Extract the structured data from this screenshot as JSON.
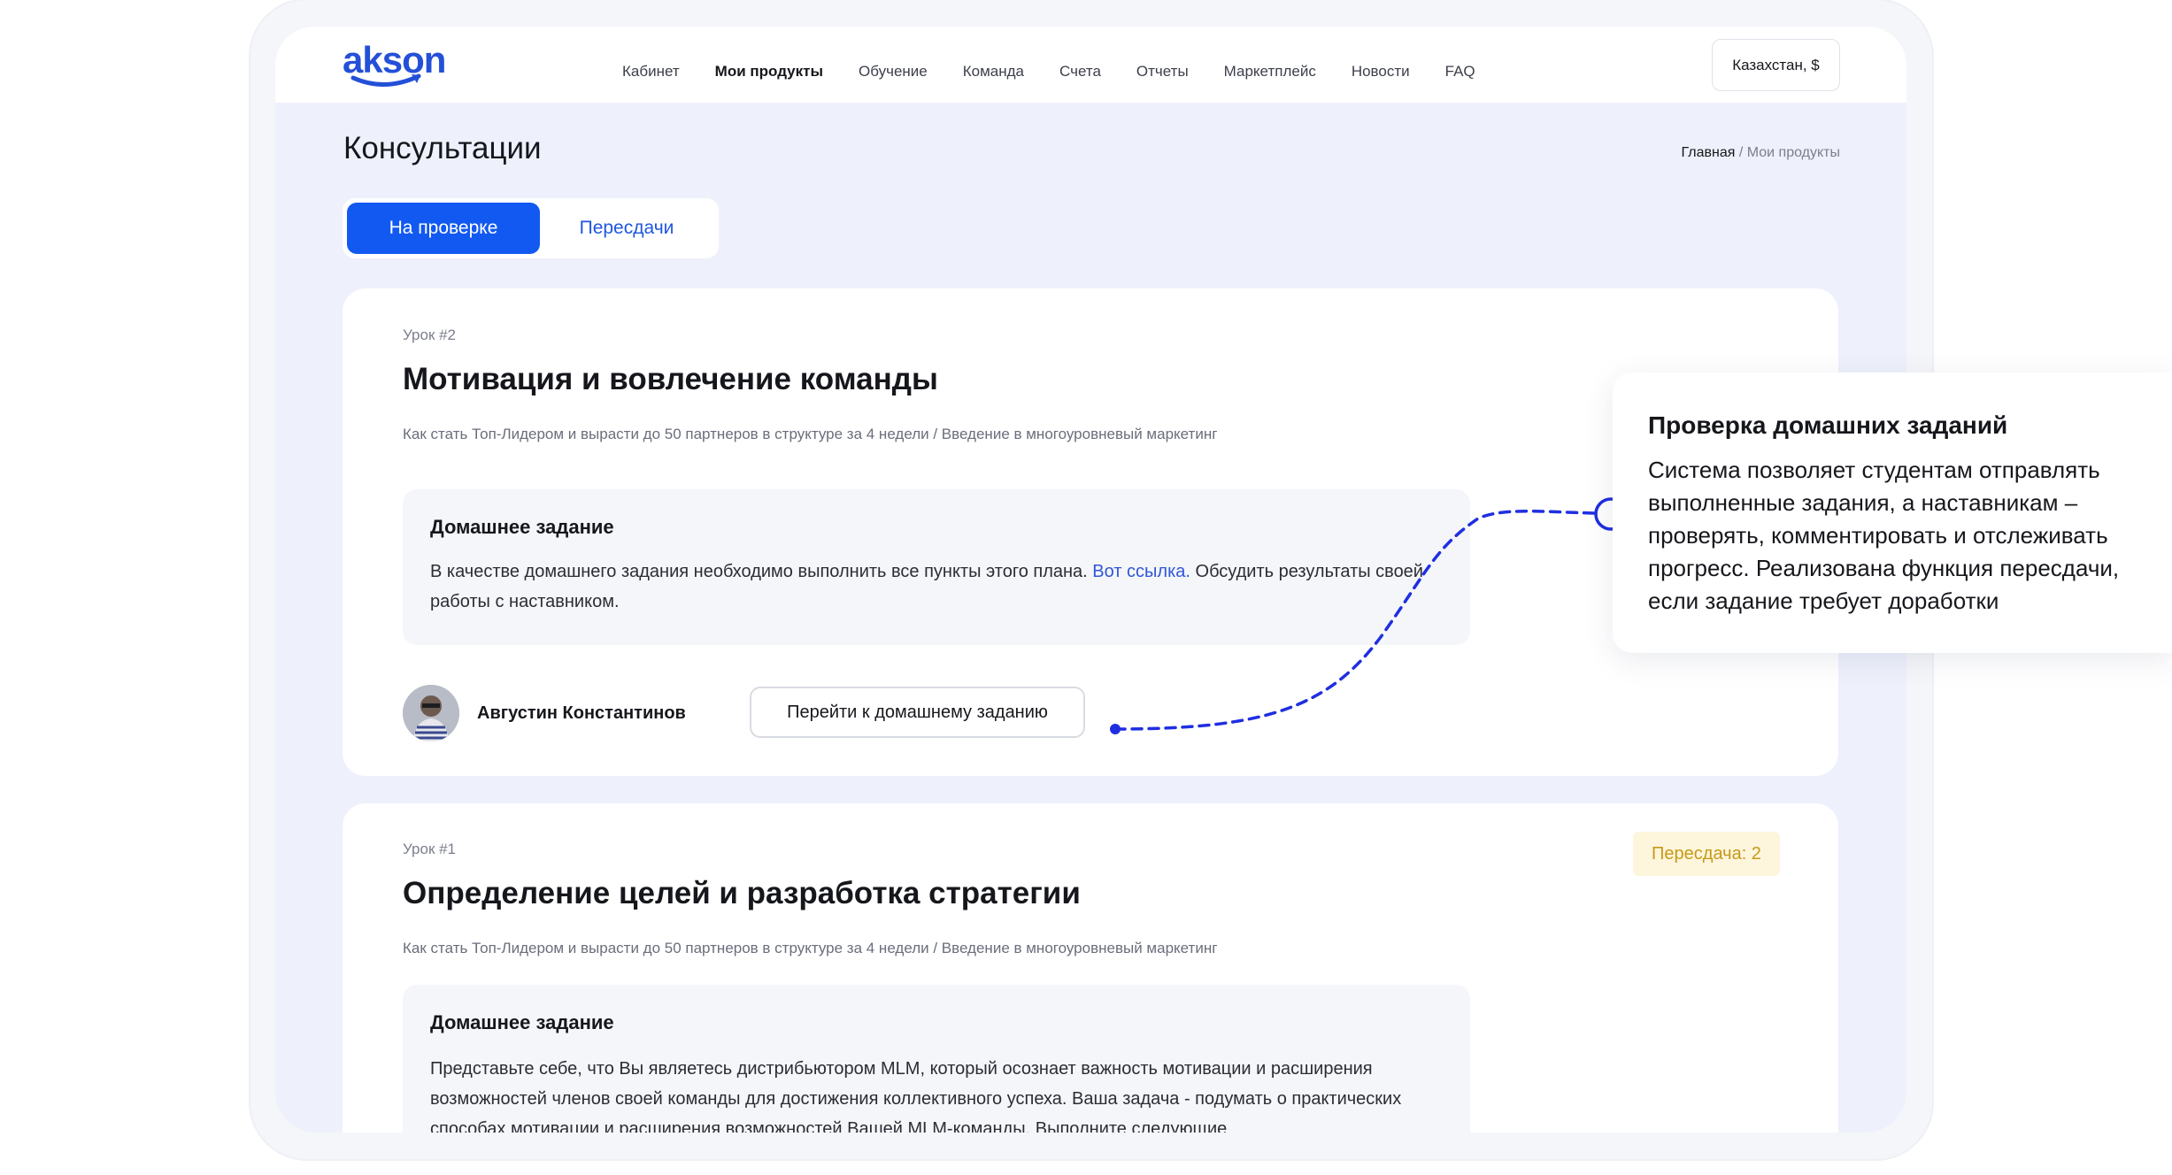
{
  "header": {
    "logo": "akson",
    "nav": [
      "Кабинет",
      "Мои продукты",
      "Обучение",
      "Команда",
      "Счета",
      "Отчеты",
      "Маркетплейс",
      "Новости",
      "FAQ"
    ],
    "active_nav": "Мои продукты",
    "region": "Казахстан, $"
  },
  "page": {
    "title": "Консультации",
    "breadcrumb_home": "Главная",
    "breadcrumb_sep": " / ",
    "breadcrumb_current": "Мои продукты"
  },
  "tabs": {
    "active": "На проверке",
    "inactive": "Пересдачи"
  },
  "lessons": [
    {
      "number": "Урок #2",
      "title": "Мотивация и вовлечение команды",
      "path": "Как стать Топ-Лидером и вырасти до 50 партнеров в структуре за 4 недели /  Введение в многоуровневый маркетинг",
      "hw_title": "Домашнее задание",
      "hw_text_before": "В качестве домашнего задания необходимо выполнить все пункты этого плана. ",
      "hw_link": "Вот ссылка.",
      "hw_text_after": " Обсудить результаты своей работы с наставником.",
      "author": "Августин Константинов",
      "button": "Перейти к домашнему заданию"
    },
    {
      "number": "Урок #1",
      "title": "Определение целей и разработка стратегии",
      "path": "Как стать Топ-Лидером и вырасти до 50 партнеров в структуре за 4 недели /  Введение в многоуровневый маркетинг",
      "hw_title": "Домашнее задание",
      "hw_text": "Представьте себе, что Вы являетесь дистрибьютором MLM, который осознает важность мотивации и расширения возможностей членов своей команды для достижения коллективного успеха. Ваша задача - подумать о практических способах мотивации и расширения возможностей Вашей MLM-команды. Выполните следующие",
      "badge": "Пересдача: 2"
    }
  ],
  "callout": {
    "title": "Проверка домашних заданий",
    "text": "Система позволяет студентам отправлять выполненные задания, а наставникам – проверять, комментировать и отслеживать прогресс. Реализована функция пересдачи, если задание требует доработки"
  },
  "colors": {
    "accent": "#1259f2",
    "connector": "#1f2fe0",
    "badge_bg": "#fdf5dc",
    "badge_text": "#c79a17"
  },
  "icons": [
    "logo-smile-icon",
    "avatar-photo"
  ]
}
